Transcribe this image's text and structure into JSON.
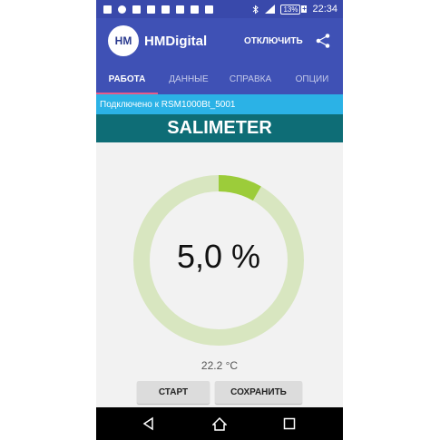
{
  "status_bar": {
    "battery": "13%",
    "battery_charging": "+",
    "time": "22:34",
    "icons": [
      "battery-low-icon",
      "shield-icon",
      "wrench-icon",
      "image-icon",
      "download-icon",
      "lock-icon",
      "message-icon",
      "document-icon",
      "bluetooth-icon",
      "signal-icon"
    ]
  },
  "app_bar": {
    "logo_text": "HM",
    "title": "HMDigital",
    "disconnect_label": "ОТКЛЮЧИТЬ"
  },
  "tabs": [
    {
      "label": "РАБОТА",
      "active": true
    },
    {
      "label": "ДАННЫЕ",
      "active": false
    },
    {
      "label": "СПРАВКА",
      "active": false
    },
    {
      "label": "ОПЦИИ",
      "active": false
    }
  ],
  "connection": {
    "text": "Подключено к RSM1000Bt_5001"
  },
  "header": {
    "title": "SALIMETER"
  },
  "gauge": {
    "value_text": "5,0 %",
    "fill_fraction": 0.083,
    "track_color": "#d8e6c0",
    "fill_color": "#9ccc3a"
  },
  "temperature": "22.2 °C",
  "buttons": {
    "start_label": "СТАРТ",
    "save_label": "СОХРАНИТЬ"
  },
  "colors": {
    "status_bar": "#3949ab",
    "app_bar": "#3f51b5",
    "tab_indicator": "#e85a8a",
    "connection_strip": "#2bb2e6",
    "header": "#0e6d76"
  }
}
